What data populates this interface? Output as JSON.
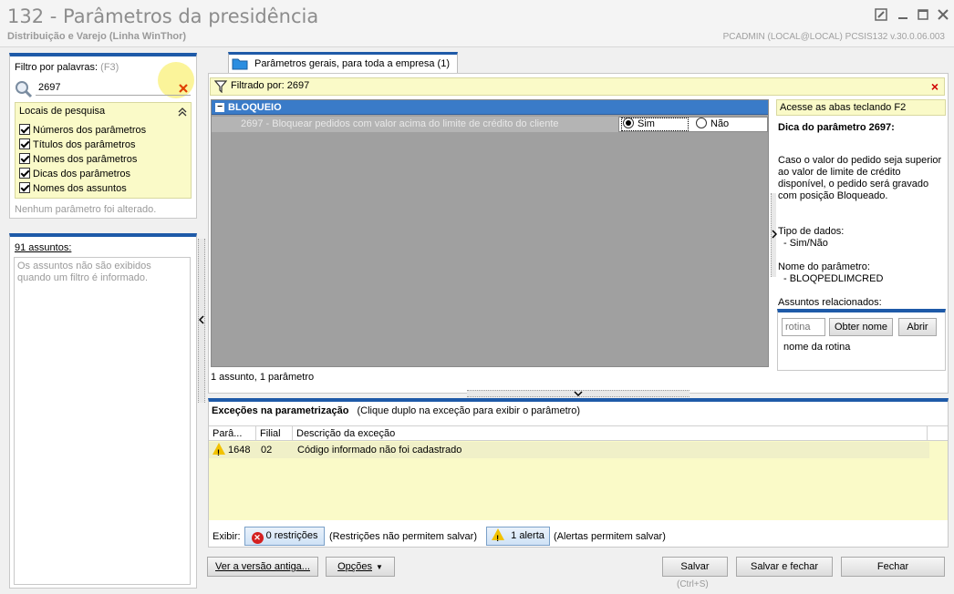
{
  "window": {
    "title": "132 - Parâmetros da presidência",
    "subtitle": "Distribuição e Varejo (Linha WinThor)",
    "userinfo": "PCADMIN (LOCAL@LOCAL)   PCSIS132  v.30.0.06.003"
  },
  "filter": {
    "label": "Filtro por palavras:",
    "shortcut": "(F3)",
    "value": "2697",
    "search_locations_title": "Locais de pesquisa",
    "options": [
      "Números dos parâmetros",
      "Títulos dos parâmetros",
      "Nomes dos parâmetros",
      "Dicas dos parâmetros",
      "Nomes dos assuntos"
    ],
    "status": "Nenhum parâmetro foi alterado."
  },
  "subjects": {
    "count_label": "91 assuntos:",
    "empty_message": "Os assuntos não são exibidos quando um filtro é informado."
  },
  "tab": {
    "label": "Parâmetros gerais, para toda a empresa  (1)"
  },
  "filterbar": {
    "text": "Filtrado por: 2697",
    "close": "×"
  },
  "grid": {
    "group": "BLOQUEIO",
    "group_toggle": "−",
    "param_text": "2697 - Bloquear pedidos com valor acima do limite de crédito do cliente",
    "yes": "Sim",
    "no": "Não",
    "summary": "1 assunto, 1 parâmetro"
  },
  "hint": {
    "header": "Acesse as abas teclando F2",
    "title": "Dica do parâmetro 2697:",
    "body": "Caso o valor do pedido seja superior ao valor de limite de crédito disponível, o pedido será gravado com posição Bloqueado.",
    "datatype_label": "Tipo de dados:",
    "datatype_value": "- Sim/Não",
    "paramname_label": "Nome do parâmetro:",
    "paramname_value": "- BLOQPEDLIMCRED",
    "related_label": "Assuntos relacionados:",
    "routine_placeholder": "rotina",
    "get_name_button": "Obter nome",
    "open_button": "Abrir",
    "routine_name": "nome da rotina"
  },
  "exceptions": {
    "title": "Exceções na parametrização",
    "subtitle": "(Clique duplo na exceção para exibir o parâmetro)",
    "columns": [
      "Parâ...",
      "Filial",
      "Descrição da exceção"
    ],
    "rows": [
      {
        "param": "1648",
        "filial": "02",
        "desc": "Código informado não foi cadastrado"
      }
    ],
    "show_label": "Exibir:",
    "restrictions_button": "0 restrições",
    "restrictions_note": "(Restrições não permitem salvar)",
    "alerts_button": "1 alerta",
    "alerts_note": "(Alertas permitem salvar)"
  },
  "footer": {
    "old_version": "Ver a versão antiga...",
    "options": "Opções",
    "save": "Salvar",
    "save_shortcut": "(Ctrl+S)",
    "save_close": "Salvar e fechar",
    "close": "Fechar"
  },
  "colors": {
    "accent": "#1e5aa8",
    "highlight_yellow": "#fafac8",
    "group_blue": "#3a7bc8"
  }
}
